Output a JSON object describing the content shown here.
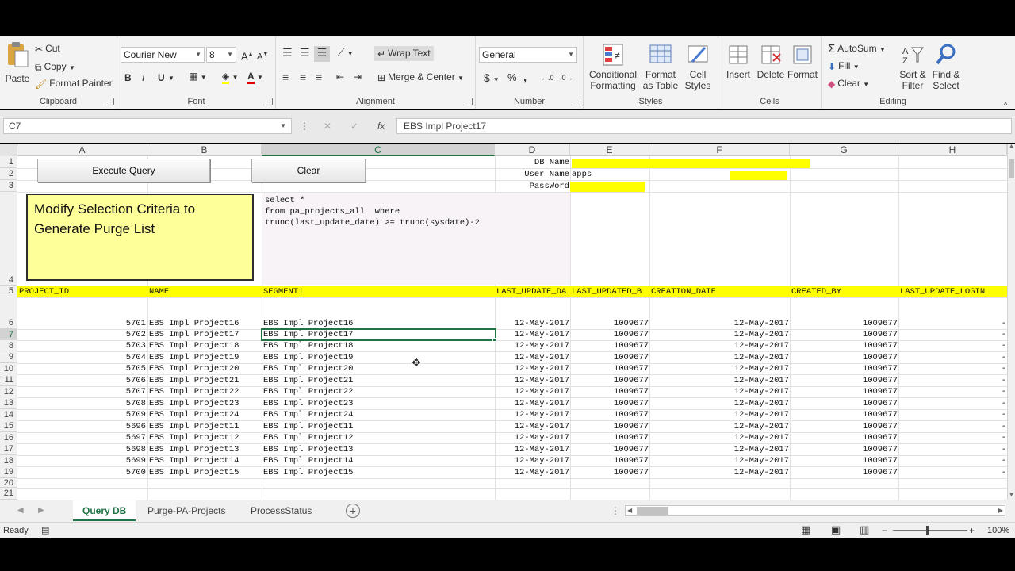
{
  "ribbon": {
    "clipboard": {
      "label": "Clipboard",
      "paste": "Paste",
      "cut": "Cut",
      "copy": "Copy",
      "format_painter": "Format Painter"
    },
    "font": {
      "label": "Font",
      "font_name": "Courier New",
      "font_size": "8",
      "bold": "B",
      "italic": "I",
      "underline": "U"
    },
    "alignment": {
      "label": "Alignment",
      "wrap_text": "Wrap Text",
      "merge_center": "Merge & Center"
    },
    "number": {
      "label": "Number",
      "format": "General",
      "currency": "$",
      "percent": "%",
      "comma": ","
    },
    "styles": {
      "label": "Styles",
      "conditional": "Conditional Formatting",
      "format_table": "Format as Table",
      "cell_styles": "Cell Styles"
    },
    "cells": {
      "label": "Cells",
      "insert": "Insert",
      "delete": "Delete",
      "format": "Format"
    },
    "editing": {
      "label": "Editing",
      "autosum": "AutoSum",
      "fill": "Fill",
      "clear": "Clear",
      "sort_filter": "Sort & Filter",
      "find_select": "Find & Select"
    }
  },
  "formula_bar": {
    "name_box": "C7",
    "formula": "EBS Impl Project17",
    "fx": "fx"
  },
  "columns": [
    "A",
    "B",
    "C",
    "D",
    "E",
    "F",
    "G",
    "H"
  ],
  "row_numbers": [
    "1",
    "2",
    "3",
    "4",
    "5",
    "6",
    "7",
    "8",
    "9",
    "10",
    "11",
    "12",
    "13",
    "14",
    "15",
    "16",
    "17",
    "18",
    "19",
    "20",
    "21"
  ],
  "controls": {
    "execute_query": "Execute Query",
    "clear": "Clear",
    "note": "Modify Selection Criteria to Generate Purge List",
    "sql": "select *\nfrom pa_projects_all  where\ntrunc(last_update_date) >= trunc(sysdate)-2",
    "db_name_label": "DB Name",
    "user_name_label": "User Name",
    "user_name_value": "apps",
    "password_label": "PassWord"
  },
  "table": {
    "headers": [
      "PROJECT_ID",
      "NAME",
      "SEGMENT1",
      "LAST_UPDATE_DA",
      "LAST_UPDATED_B",
      "CREATION_DATE",
      "CREATED_BY",
      "LAST_UPDATE_LOGIN"
    ],
    "rows": [
      [
        "5701",
        "EBS Impl Project16",
        "EBS Impl Project16",
        "12-May-2017",
        "1009677",
        "12-May-2017",
        "1009677",
        "-"
      ],
      [
        "5702",
        "EBS Impl Project17",
        "EBS Impl Project17",
        "12-May-2017",
        "1009677",
        "12-May-2017",
        "1009677",
        "-"
      ],
      [
        "5703",
        "EBS Impl Project18",
        "EBS Impl Project18",
        "12-May-2017",
        "1009677",
        "12-May-2017",
        "1009677",
        "-"
      ],
      [
        "5704",
        "EBS Impl Project19",
        "EBS Impl Project19",
        "12-May-2017",
        "1009677",
        "12-May-2017",
        "1009677",
        "-"
      ],
      [
        "5705",
        "EBS Impl Project20",
        "EBS Impl Project20",
        "12-May-2017",
        "1009677",
        "12-May-2017",
        "1009677",
        "-"
      ],
      [
        "5706",
        "EBS Impl Project21",
        "EBS Impl Project21",
        "12-May-2017",
        "1009677",
        "12-May-2017",
        "1009677",
        "-"
      ],
      [
        "5707",
        "EBS Impl Project22",
        "EBS Impl Project22",
        "12-May-2017",
        "1009677",
        "12-May-2017",
        "1009677",
        "-"
      ],
      [
        "5708",
        "EBS Impl Project23",
        "EBS Impl Project23",
        "12-May-2017",
        "1009677",
        "12-May-2017",
        "1009677",
        "-"
      ],
      [
        "5709",
        "EBS Impl Project24",
        "EBS Impl Project24",
        "12-May-2017",
        "1009677",
        "12-May-2017",
        "1009677",
        "-"
      ],
      [
        "5696",
        "EBS Impl Project11",
        "EBS Impl Project11",
        "12-May-2017",
        "1009677",
        "12-May-2017",
        "1009677",
        "-"
      ],
      [
        "5697",
        "EBS Impl Project12",
        "EBS Impl Project12",
        "12-May-2017",
        "1009677",
        "12-May-2017",
        "1009677",
        "-"
      ],
      [
        "5698",
        "EBS Impl Project13",
        "EBS Impl Project13",
        "12-May-2017",
        "1009677",
        "12-May-2017",
        "1009677",
        "-"
      ],
      [
        "5699",
        "EBS Impl Project14",
        "EBS Impl Project14",
        "12-May-2017",
        "1009677",
        "12-May-2017",
        "1009677",
        "-"
      ],
      [
        "5700",
        "EBS Impl Project15",
        "EBS Impl Project15",
        "12-May-2017",
        "1009677",
        "12-May-2017",
        "1009677",
        "-"
      ]
    ]
  },
  "sheets": {
    "tabs": [
      "Query DB",
      "Purge-PA-Projects",
      "ProcessStatus"
    ],
    "active": "Query DB"
  },
  "status": {
    "mode": "Ready",
    "zoom": "100%"
  },
  "colors": {
    "accent": "#217346",
    "highlight": "#ffff00",
    "note": "#ffff99"
  }
}
